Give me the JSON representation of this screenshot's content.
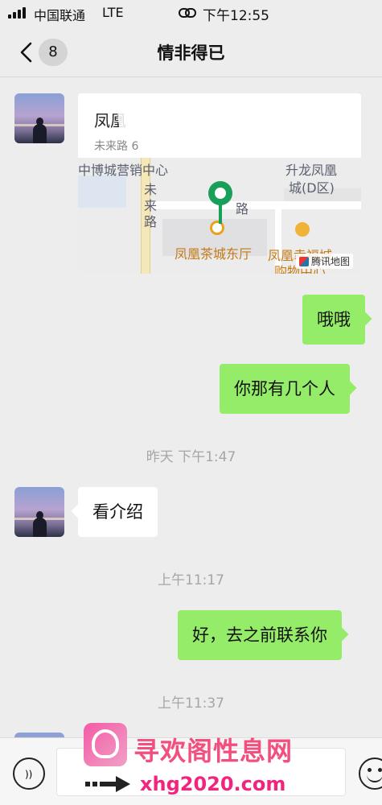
{
  "status_bar": {
    "carrier": "中国联通",
    "network": "LTE",
    "time": "下午12:55"
  },
  "header": {
    "back_count": "8",
    "title": "情非得已"
  },
  "location_message": {
    "title": "凤凰",
    "address": "未来路 6",
    "map_labels": {
      "marketing_center": "中博城营销中心",
      "shenglong": "升龙凤凰",
      "shenglong_d": "城(D区)",
      "weilai_road": "未来路",
      "road_fragment": "路",
      "teahouse": "凤凰茶城东厅",
      "xingfu": "凤凰幸福城",
      "xingfu_2": "购物中心",
      "provider": "腾讯地图"
    }
  },
  "messages": [
    {
      "side": "right",
      "text": "哦哦"
    },
    {
      "side": "right",
      "text": "你那有几个人"
    },
    {
      "side": "left",
      "text": "看介绍"
    },
    {
      "side": "right",
      "text": "好，去之前联系你"
    }
  ],
  "timestamps": [
    "昨天 下午1:47",
    "上午11:17",
    "上午11:37"
  ],
  "watermark": {
    "title": "寻欢阁性息网",
    "url": "xhg2020.com"
  },
  "colors": {
    "sent_bubble": "#95ec69",
    "received_bubble": "#ffffff",
    "background": "#ededed",
    "pin": "#18a058"
  }
}
